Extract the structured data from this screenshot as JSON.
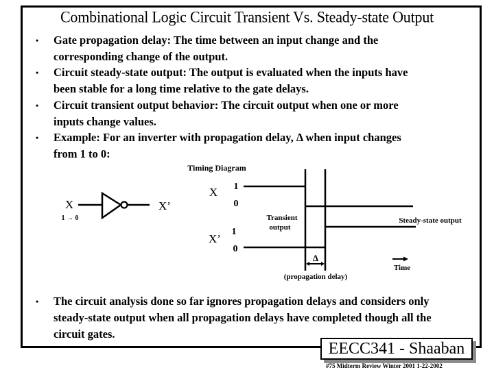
{
  "slide": {
    "title": "Combinational Logic Circuit Transient Vs. Steady-state Output",
    "bullets": [
      {
        "lines": [
          "Gate propagation delay:  The time between an input change and the",
          "corresponding change of the output."
        ]
      },
      {
        "lines": [
          "Circuit steady-state output:   The output is evaluated when the inputs have",
          "been stable for a long time relative to the gate delays."
        ]
      },
      {
        "lines": [
          "Circuit transient output behavior:   The circuit output when one or more",
          "inputs change values."
        ]
      },
      {
        "lines": [
          "Example:   For an inverter with propagation delay,  Δ   when input changes",
          "from 1 to 0:"
        ]
      }
    ],
    "final_bullet": {
      "lines": [
        "The circuit analysis done so far ignores propagation delays and considers only",
        "steady-state output when all propagation delays have completed though all the",
        "circuit gates."
      ]
    },
    "bullet_glyph": "•"
  },
  "diagram": {
    "title": "Timing Diagram",
    "inverter": {
      "input_label": "X",
      "output_label": "X’",
      "transition_label": "1 → 0"
    },
    "signals": [
      {
        "name": "X",
        "high_label": "1",
        "low_label": "0"
      },
      {
        "name": "X’",
        "high_label": "1",
        "low_label": "0"
      }
    ],
    "transient_label_line1": "Transient",
    "transient_label_line2": "output",
    "steady_label": "Steady-state output",
    "delta_label": "Δ",
    "delay_label": "(propagation delay)",
    "time_label": "Time"
  },
  "footer": {
    "course": "EECC341 - Shaaban",
    "note": "#75   Midterm Review   Winter 2001  1-22-2002"
  }
}
